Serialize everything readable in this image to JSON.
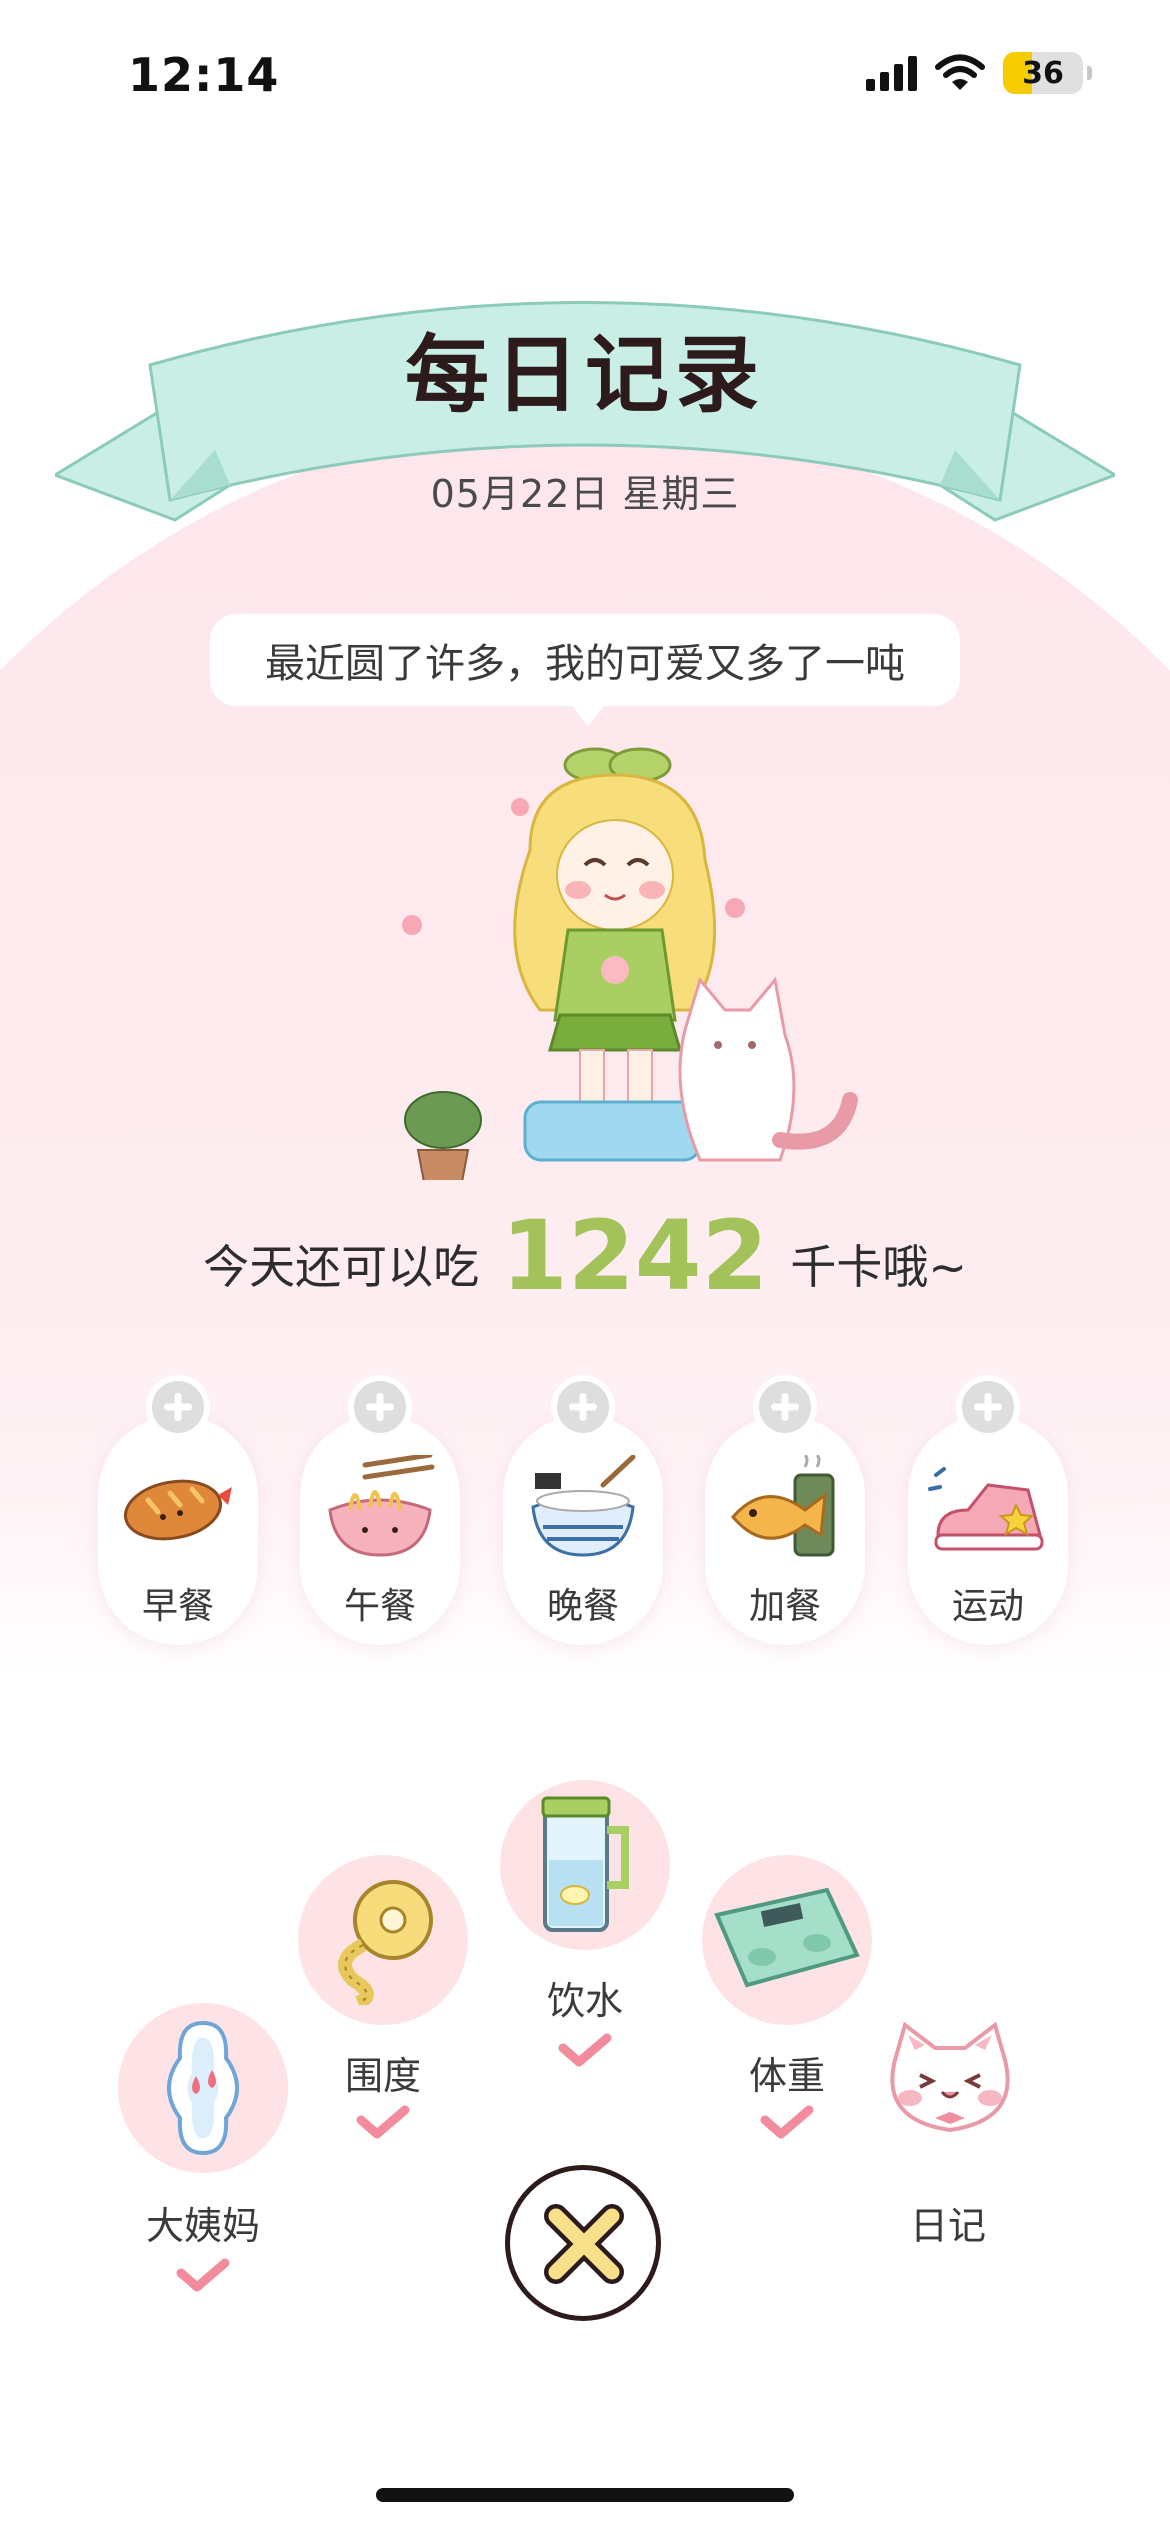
{
  "status_bar": {
    "time": "12:14",
    "battery": "36",
    "battery_fraction": 0.36,
    "icons": [
      "signal-icon",
      "wifi-icon",
      "battery-icon"
    ]
  },
  "header": {
    "title": "每日记录",
    "date": "05月22日 星期三"
  },
  "bubble": {
    "text": "最近圆了许多，我的可爱又多了一吨"
  },
  "calories": {
    "prefix": "今天还可以吃",
    "value": "1242",
    "suffix": "千卡哦~"
  },
  "meals": [
    {
      "label": "早餐",
      "icon": "bread-icon"
    },
    {
      "label": "午餐",
      "icon": "noodle-bowl-icon"
    },
    {
      "label": "晚餐",
      "icon": "rice-bowl-icon"
    },
    {
      "label": "加餐",
      "icon": "taiyaki-icon"
    },
    {
      "label": "运动",
      "icon": "sneaker-icon"
    }
  ],
  "trackers": [
    {
      "label": "大姨妈",
      "icon": "pad-icon",
      "checked": true
    },
    {
      "label": "围度",
      "icon": "tape-measure-icon",
      "checked": true
    },
    {
      "label": "饮水",
      "icon": "water-jug-icon",
      "checked": true
    },
    {
      "label": "体重",
      "icon": "scale-icon",
      "checked": true
    },
    {
      "label": "日记",
      "icon": "cat-face-icon",
      "checked": false
    }
  ],
  "colors": {
    "accent_green": "#a3c35a",
    "pink_bg": "#fde6ec",
    "ribbon": "#c9eee6",
    "check_pink": "#f28b9b"
  }
}
